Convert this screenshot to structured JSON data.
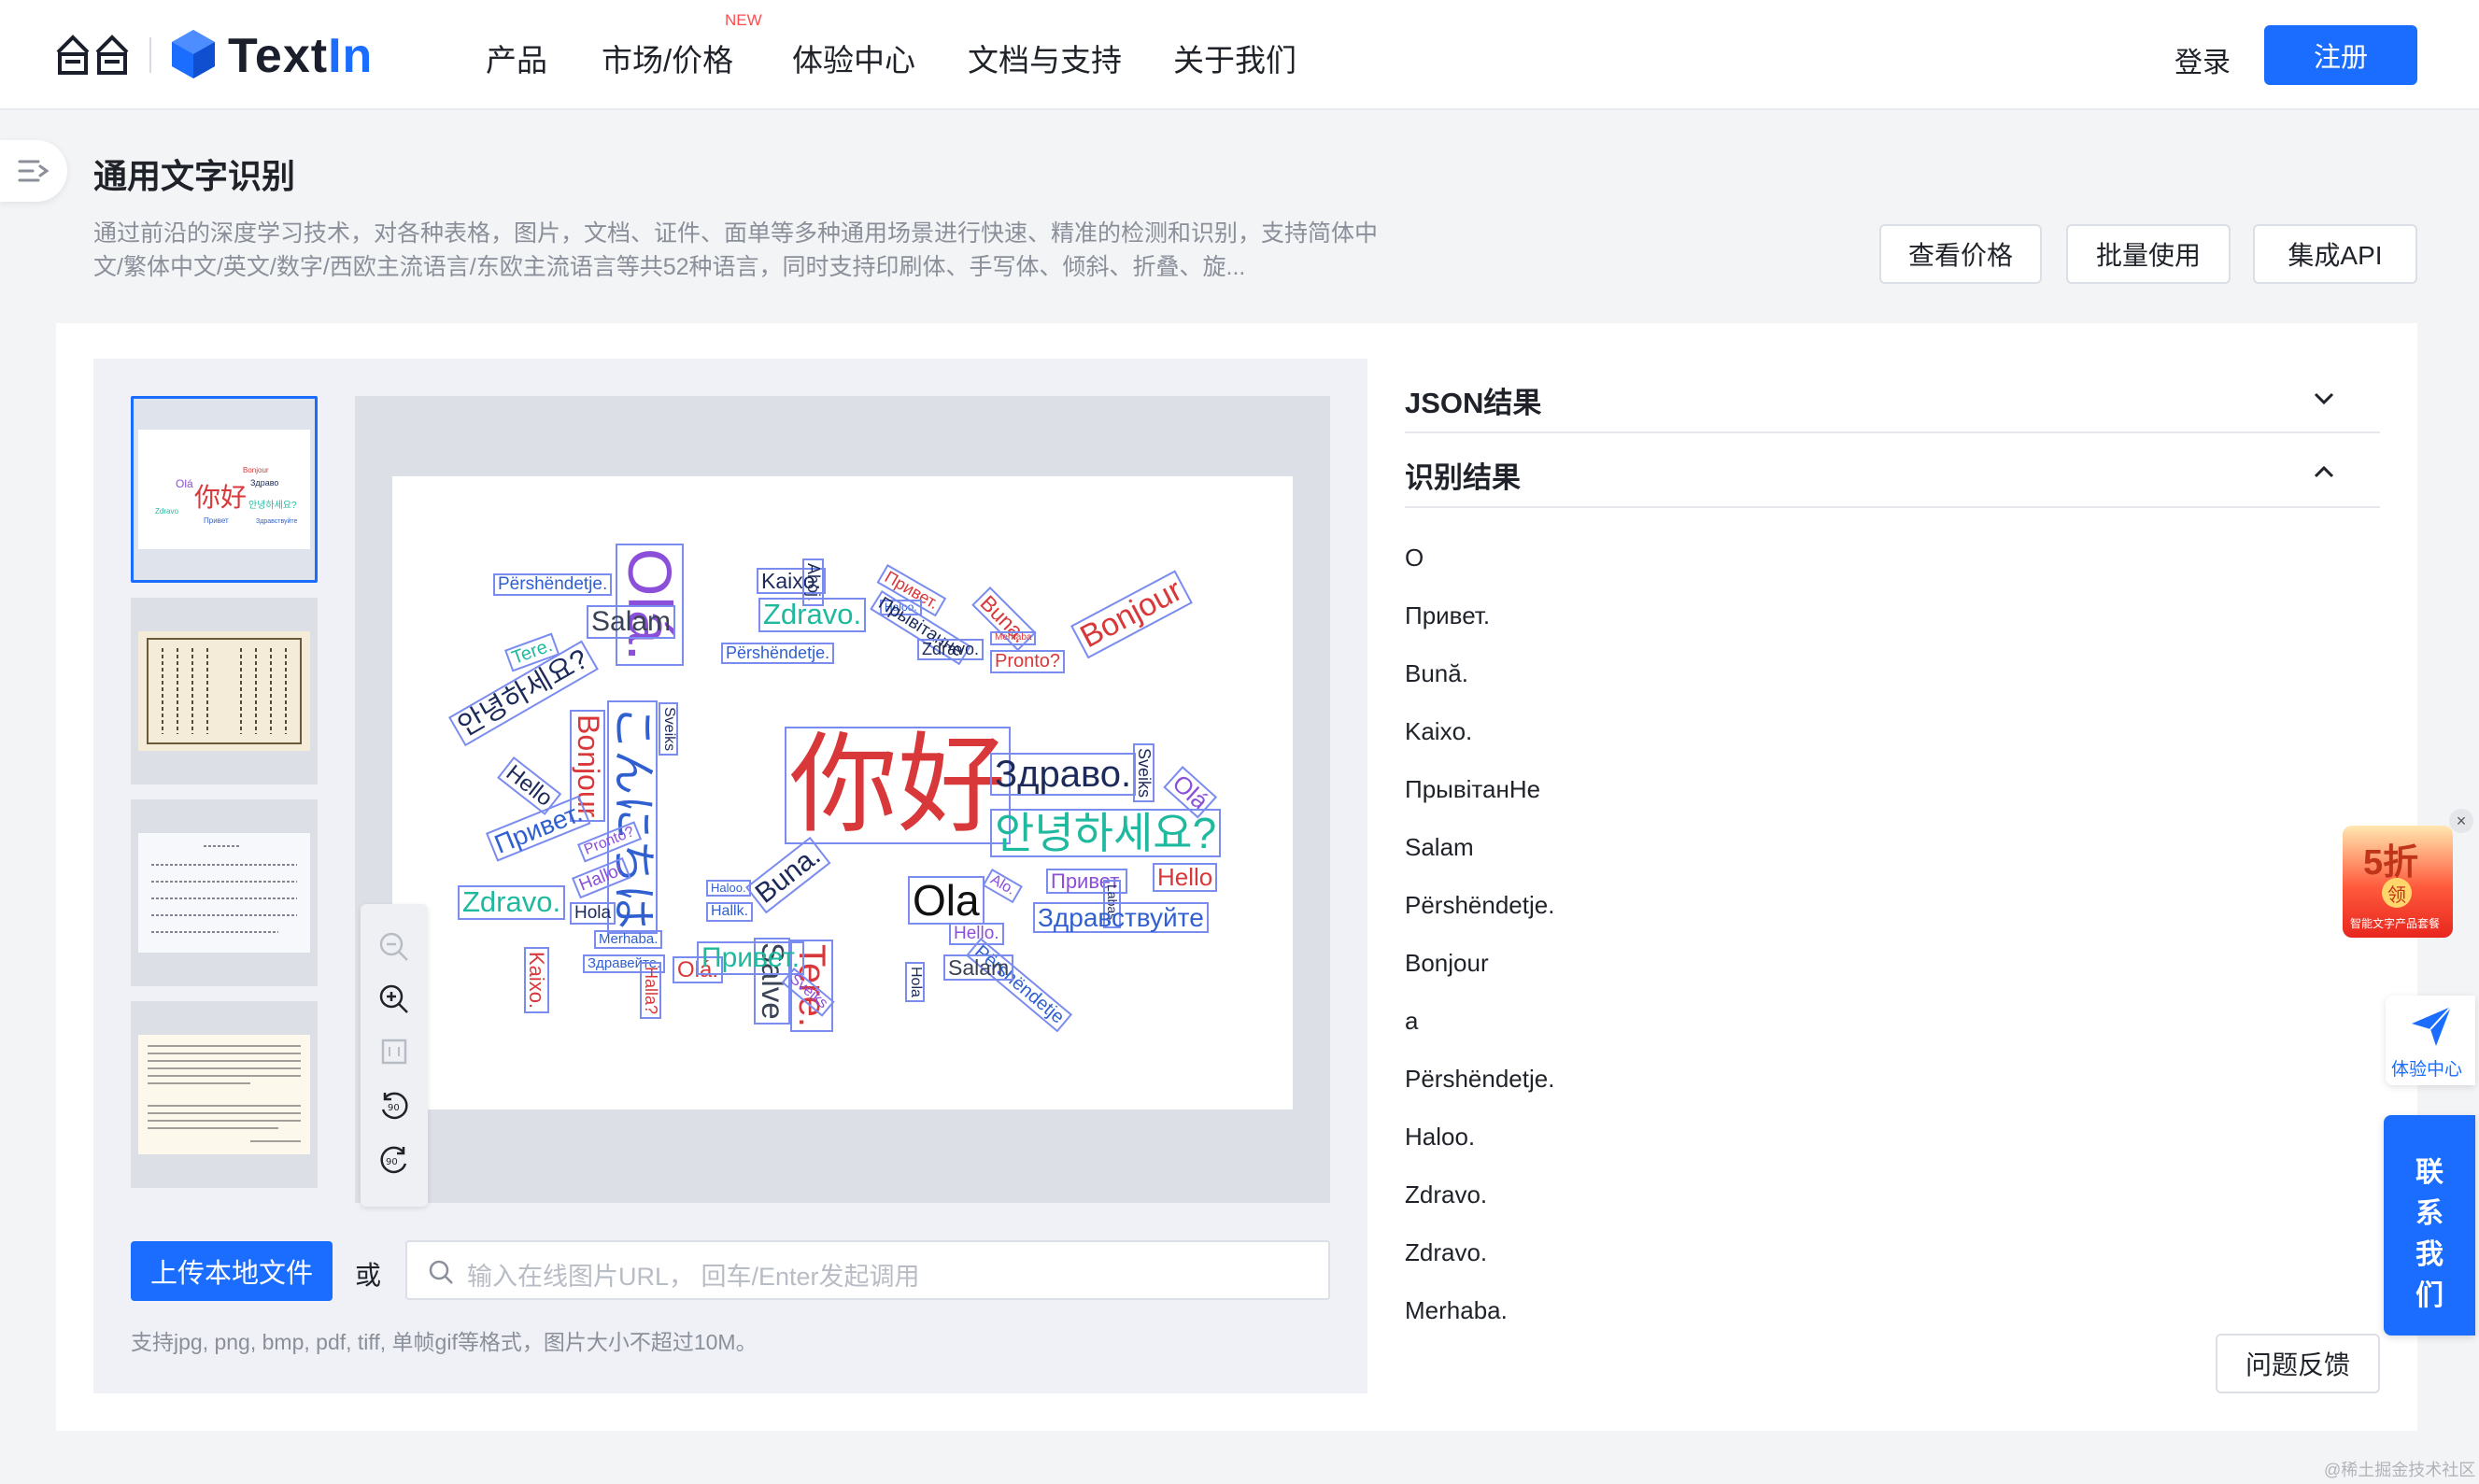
{
  "nav": {
    "logo_text_main": "Text",
    "logo_text_accent": "In",
    "items": [
      "产品",
      "市场/价格",
      "体验中心",
      "文档与支持",
      "关于我们"
    ],
    "new_badge": "NEW",
    "login": "登录",
    "register": "注册"
  },
  "header": {
    "title": "通用文字识别",
    "description": "通过前沿的深度学习技术，对各种表格，图片，文档、证件、面单等多种通用场景进行快速、精准的检测和识别，支持简体中文/繁体中文/英文/数字/西欧主流语言/东欧主流语言等共52种语言，同时支持印刷体、手写体、倾斜、折叠、旋...",
    "buttons": [
      "查看价格",
      "批量使用",
      "集成API"
    ]
  },
  "upload": {
    "button": "上传本地文件",
    "or": "或",
    "url_placeholder": "输入在线图片URL， 回车/Enter发起调用",
    "support_text": "支持jpg, png, bmp, pdf, tiff, 单帧gif等格式，图片大小不超过10M。"
  },
  "results": {
    "json_label": "JSON结果",
    "recognition_label": "识别结果",
    "lines": [
      "O",
      "Привет.",
      "Bună.",
      "Kaixo.",
      "ПрывітанНе",
      "Salam",
      "Përshëndetje.",
      "Bonjour",
      "a",
      "Përshëndetje.",
      "Haloo.",
      "Zdravo.",
      "Zdravo.",
      "Merhaba."
    ],
    "feedback": "问题反馈"
  },
  "wordcloud": {
    "words": [
      "Olá.",
      "Përshëndetje.",
      "Kaixo.",
      "Ahoj.",
      "Привет.",
      "Salam",
      "Zdravo.",
      "Haloo.",
      "Прывітанне",
      "Buna.",
      "Tere.",
      "안녕하세요?",
      "Përshëndetje.",
      "Zdravo.",
      "Merhaba",
      "Pronto?",
      "Bonjour",
      "Hello",
      "Bonjour",
      "こんにちは",
      "Sveiks",
      "你好",
      "Здраво.",
      "Sveiks",
      "Olá",
      "안녕하세요?",
      "Привет.",
      "Pronto?",
      "Hallo!",
      "Zdravo.",
      "Haloo.",
      "Hallk.",
      "Buna.",
      "Salve",
      "Tere.",
      "Ola",
      "Alo.",
      "Привет.",
      "Labas.",
      "Hello",
      "Здравствуйте",
      "Kaixo.",
      "Hola",
      "Merhaba.",
      "Здравейте.",
      "Halla?",
      "Olá.",
      "Привет.",
      "Sveiks",
      "Hola",
      "Hello.",
      "Përshëndetje",
      "Salam"
    ]
  },
  "widgets": {
    "promo_discount": "5折",
    "promo_claim": "领",
    "promo_sub": "智能文字产品套餐",
    "experience_center": "体验中心",
    "contact": [
      "联",
      "系",
      "我",
      "们"
    ],
    "watermark": "@稀土掘金技术社区"
  },
  "colors": {
    "primary": "#1a6dff",
    "wc_red": "#d9383a",
    "wc_purple": "#8b4fd9",
    "wc_teal": "#1fb9a0",
    "wc_navy": "#1c2a5a",
    "wc_blue": "#2f5fd0"
  }
}
